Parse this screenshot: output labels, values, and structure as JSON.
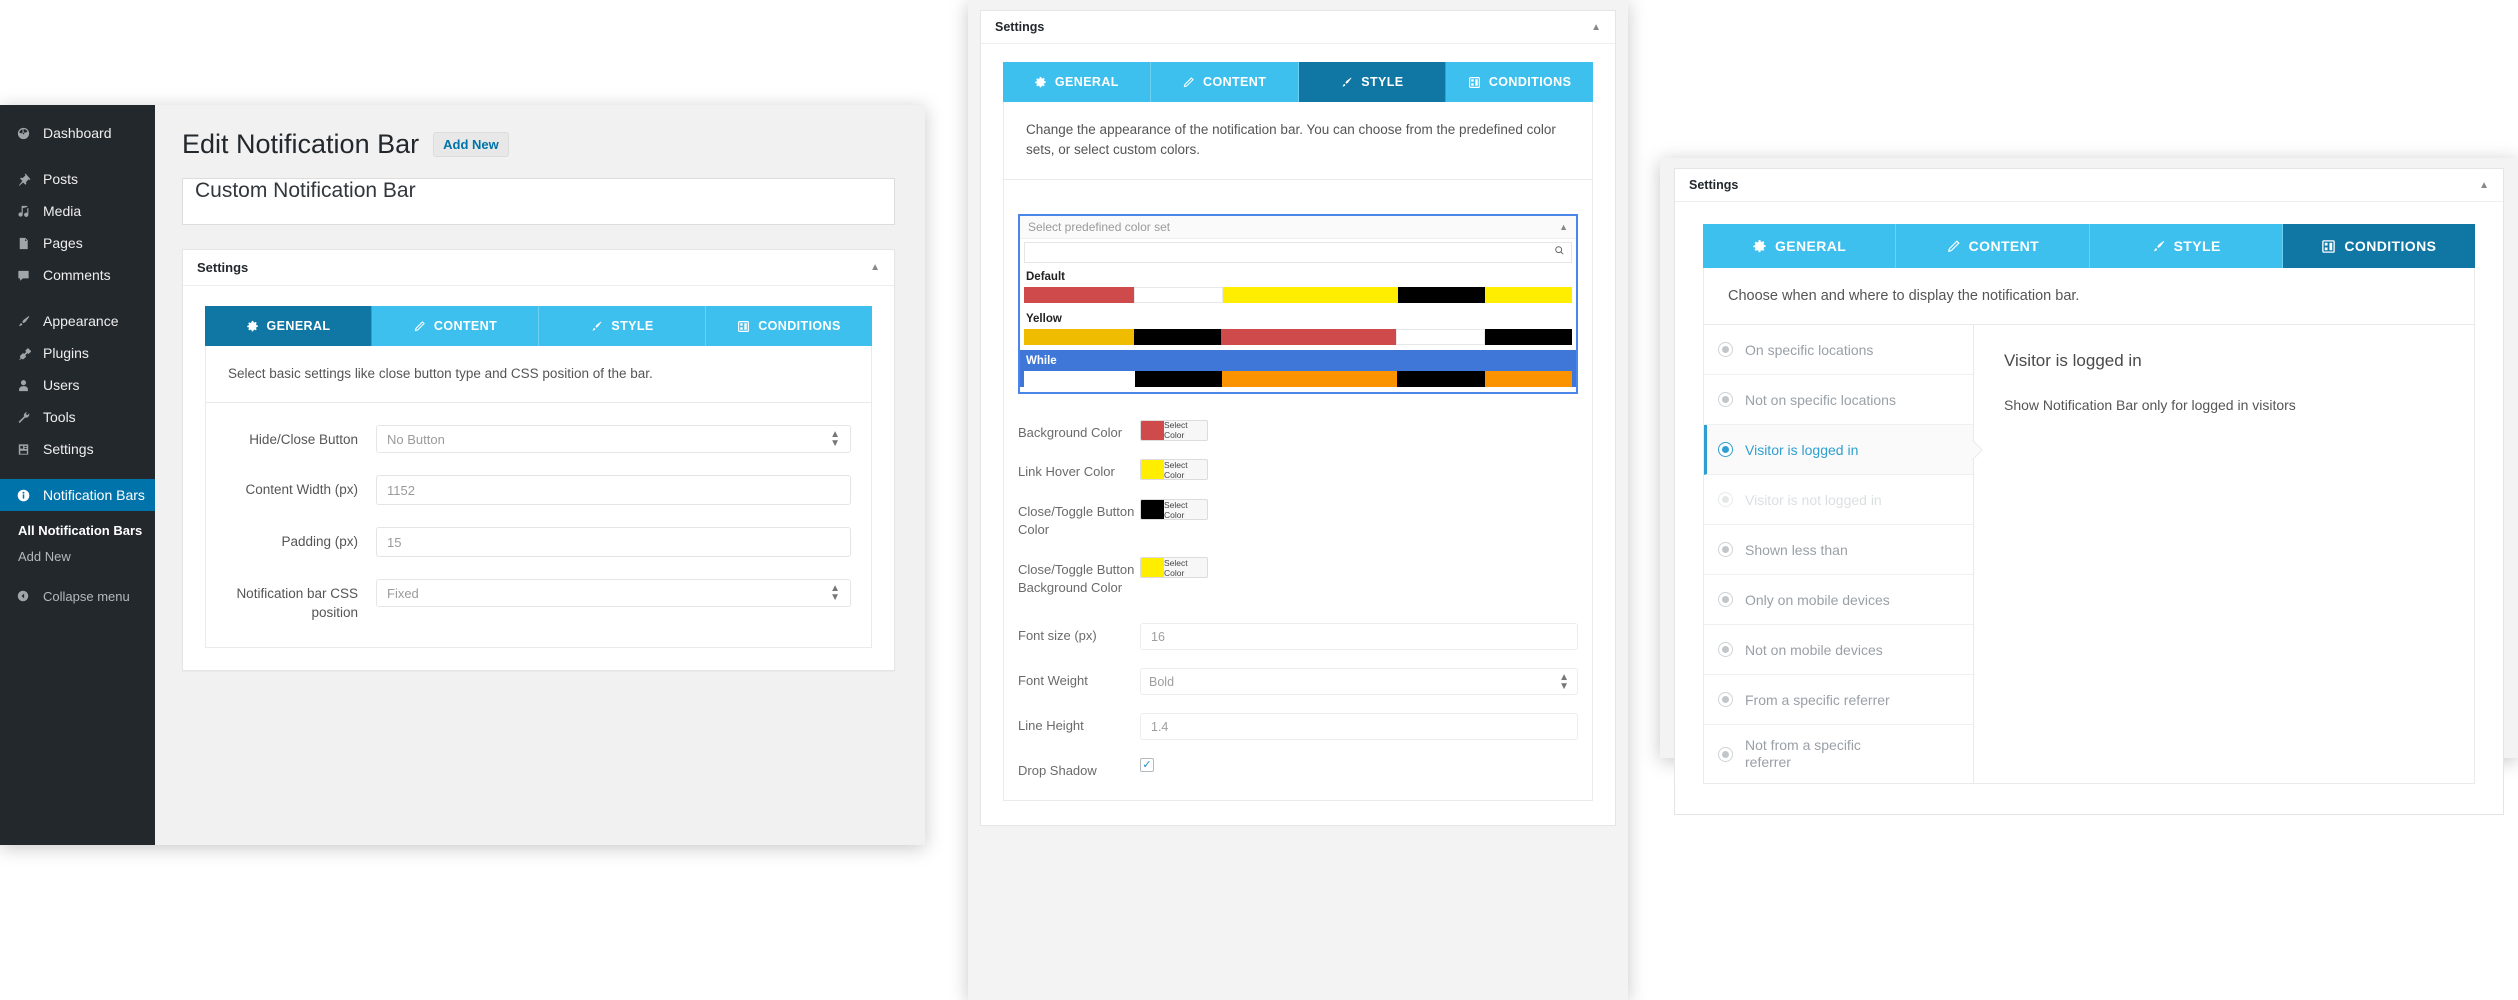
{
  "wp_sidebar": {
    "items": [
      {
        "label": "Dashboard",
        "icon": "dashboard-icon"
      },
      {
        "label": "Posts",
        "icon": "pin-icon"
      },
      {
        "label": "Media",
        "icon": "media-icon"
      },
      {
        "label": "Pages",
        "icon": "pages-icon"
      },
      {
        "label": "Comments",
        "icon": "comment-icon"
      },
      {
        "label": "Appearance",
        "icon": "brush-icon"
      },
      {
        "label": "Plugins",
        "icon": "plug-icon"
      },
      {
        "label": "Users",
        "icon": "user-icon"
      },
      {
        "label": "Tools",
        "icon": "wrench-icon"
      },
      {
        "label": "Settings",
        "icon": "settings-icon"
      },
      {
        "label": "Notification Bars",
        "icon": "info-icon"
      }
    ],
    "submenu": [
      {
        "label": "All Notification Bars",
        "current": true
      },
      {
        "label": "Add New",
        "current": false
      }
    ],
    "collapse_label": "Collapse menu"
  },
  "left": {
    "page_title": "Edit Notification Bar",
    "add_new_label": "Add New",
    "title_value": "Custom Notification Bar",
    "metabox_title": "Settings",
    "tabs": [
      {
        "label": "GENERAL",
        "icon": "gear-icon",
        "active": true
      },
      {
        "label": "CONTENT",
        "icon": "pencil-icon",
        "active": false
      },
      {
        "label": "STYLE",
        "icon": "brush-icon",
        "active": false
      },
      {
        "label": "CONDITIONS",
        "icon": "grid-icon",
        "active": false
      }
    ],
    "description": "Select basic settings like close button type and CSS position of the bar.",
    "fields": [
      {
        "label": "Hide/Close Button",
        "value": "No Button",
        "type": "select"
      },
      {
        "label": "Content Width (px)",
        "value": "1152",
        "type": "text"
      },
      {
        "label": "Padding (px)",
        "value": "15",
        "type": "text"
      },
      {
        "label": "Notification bar CSS position",
        "value": "Fixed",
        "type": "select"
      }
    ]
  },
  "middle": {
    "metabox_title": "Settings",
    "tabs": [
      {
        "label": "GENERAL",
        "icon": "gear-icon",
        "active": false
      },
      {
        "label": "CONTENT",
        "icon": "pencil-icon",
        "active": false
      },
      {
        "label": "STYLE",
        "icon": "brush-icon",
        "active": true
      },
      {
        "label": "CONDITIONS",
        "icon": "grid-icon",
        "active": false
      }
    ],
    "description": "Change the appearance of the notification bar. You can choose from the predefined color sets, or select custom colors.",
    "colorset": {
      "placeholder": "Select predefined color set",
      "search_value": "",
      "search_icon": "search-icon",
      "options": [
        {
          "label": "Default",
          "selected": false,
          "swatches": [
            "#cf4b4b",
            "#ffffff",
            "#ffee00",
            "#000000",
            "#ffee00"
          ]
        },
        {
          "label": "Yellow",
          "selected": false,
          "swatches": [
            "#efbc00",
            "#000000",
            "#cf4b4b",
            "#ffffff",
            "#000000"
          ]
        },
        {
          "label": "While",
          "selected": true,
          "swatches": [
            "#ffffff",
            "#000000",
            "#fb9200",
            "#000000",
            "#fb9200"
          ]
        }
      ]
    },
    "color_fields": [
      {
        "label": "Background Color",
        "swatch": "#cf4b4b",
        "button": "Select Color"
      },
      {
        "label": "Link Hover Color",
        "swatch": "#ffee00",
        "button": "Select Color"
      },
      {
        "label": "Close/Toggle Button Color",
        "swatch": "#000000",
        "button": "Select Color"
      },
      {
        "label": "Close/Toggle Button Background Color",
        "swatch": "#ffee00",
        "button": "Select Color"
      }
    ],
    "text_fields": [
      {
        "label": "Font size (px)",
        "value": "16",
        "type": "text"
      },
      {
        "label": "Font Weight",
        "value": "Bold",
        "type": "select"
      },
      {
        "label": "Line Height",
        "value": "1.4",
        "type": "text"
      }
    ],
    "checkbox_field": {
      "label": "Drop Shadow",
      "checked": true
    }
  },
  "right": {
    "metabox_title": "Settings",
    "tabs": [
      {
        "label": "GENERAL",
        "icon": "gear-icon",
        "active": false
      },
      {
        "label": "CONTENT",
        "icon": "pencil-icon",
        "active": false
      },
      {
        "label": "STYLE",
        "icon": "brush-icon",
        "active": false
      },
      {
        "label": "CONDITIONS",
        "icon": "grid-icon",
        "active": true
      }
    ],
    "description": "Choose when and where to display the notification bar.",
    "conditions": [
      {
        "label": "On specific locations",
        "state": "normal"
      },
      {
        "label": "Not on specific locations",
        "state": "normal"
      },
      {
        "label": "Visitor is logged in",
        "state": "active"
      },
      {
        "label": "Visitor is not logged in",
        "state": "dim"
      },
      {
        "label": "Shown less than",
        "state": "normal"
      },
      {
        "label": "Only on mobile devices",
        "state": "normal"
      },
      {
        "label": "Not on mobile devices",
        "state": "normal"
      },
      {
        "label": "From a specific referrer",
        "state": "normal"
      },
      {
        "label": "Not from a specific referrer",
        "state": "normal"
      }
    ],
    "detail_title": "Visitor is logged in",
    "detail_text": "Show Notification Bar only for logged in visitors"
  },
  "colors": {
    "tab_active": "#1076a3",
    "tab_inactive": "#3ec0ee",
    "wp_blue": "#0073aa",
    "wp_dark": "#23282d",
    "accent": "#2f9fd0"
  }
}
